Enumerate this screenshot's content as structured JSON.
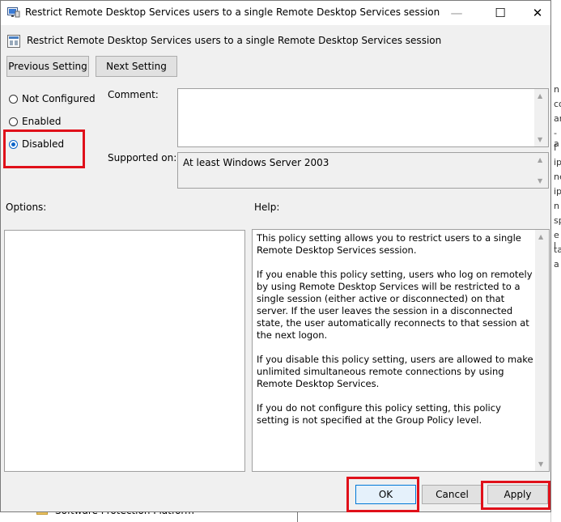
{
  "window": {
    "title": "Restrict Remote Desktop Services users to a single Remote Desktop Services session",
    "minimize_glyph": "—",
    "maximize_glyph": "☐",
    "close_glyph": "✕"
  },
  "header": {
    "title": "Restrict Remote Desktop Services users to a single Remote Desktop Services session"
  },
  "nav": {
    "previous_label": "Previous Setting",
    "next_label": "Next Setting"
  },
  "state": {
    "options": [
      {
        "label": "Not Configured",
        "selected": false
      },
      {
        "label": "Enabled",
        "selected": false
      },
      {
        "label": "Disabled",
        "selected": true
      }
    ]
  },
  "comment": {
    "label": "Comment:",
    "value": ""
  },
  "supported": {
    "label": "Supported on:",
    "value": "At least Windows Server 2003"
  },
  "options_panel": {
    "label": "Options:"
  },
  "help_panel": {
    "label": "Help:",
    "paragraphs": [
      "This policy setting allows you to restrict users to a single Remote Desktop Services session.",
      "If you enable this policy setting, users who log on remotely by using Remote Desktop Services will be restricted to a single session (either active or disconnected) on that server. If the user leaves the session in a disconnected state, the user automatically reconnects to that session at the next logon.",
      "If you disable this policy setting, users are allowed to make unlimited simultaneous remote connections by using Remote Desktop Services.",
      "If you do not configure this policy setting,  this policy setting is not specified at the Group Policy level."
    ]
  },
  "footer": {
    "ok_label": "OK",
    "cancel_label": "Cancel",
    "apply_label": "Apply"
  },
  "background": {
    "tree_item": "Software Protection Platform",
    "right_edge_fragments": [
      "n",
      "co",
      "ar",
      "-a",
      "f",
      "ip",
      "ne",
      "ip",
      "n",
      "sp",
      "e l",
      "ta",
      "a"
    ]
  },
  "colors": {
    "highlight": "#e0101a",
    "accent": "#0a64c8",
    "dialog_bg": "#f0f0f0"
  },
  "icons": {
    "window_icon": "policy-window-icon",
    "header_icon": "policy-setting-icon",
    "folder_icon": "folder-icon"
  }
}
